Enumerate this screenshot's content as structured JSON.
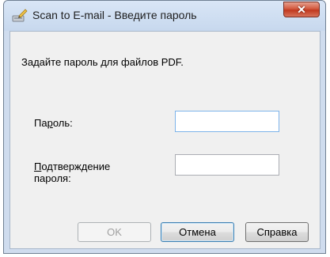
{
  "window": {
    "title": "Scan to E-mail - Введите пароль"
  },
  "dialog": {
    "instruction": "Задайте пароль для файлов PDF.",
    "password_label_hotkey": "р",
    "password_label_pre": "Па",
    "password_label_post": "оль:",
    "password_value": "",
    "confirm_label_hotkey": "П",
    "confirm_label_line1_rest": "одтверждение",
    "confirm_label_line2": "пароля:",
    "confirm_value": ""
  },
  "buttons": {
    "ok": "OK",
    "cancel": "Отмена",
    "help": "Справка"
  },
  "colors": {
    "close_button": "#c0391f",
    "client_bg": "#f0f0f0",
    "frame": "#cfdcee"
  },
  "icons": {
    "app": "scanner-pencil-icon",
    "close": "close-icon"
  }
}
